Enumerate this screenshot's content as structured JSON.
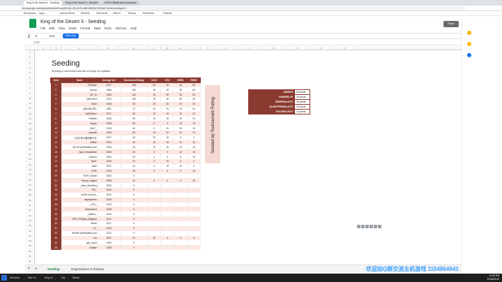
{
  "browser": {
    "tabs": [
      {
        "label": "King of the Desert 3 - Seeding"
      },
      {
        "label": "King of the Desert 3 - Bracket"
      },
      {
        "label": "KOD3 Official Announcement"
      }
    ],
    "url": "docs.google.com/spreadsheets/d/1sqkDiHuLh-5iXnFZh-w8KeBd3Is1HZ9wk9Tq/htmlview#gid=0",
    "bookmarks": [
      "Bookmarks",
      "Apps",
      "Android Boss",
      "Reverse",
      "Overmuse",
      "Sktech",
      "Bootsy",
      "Jw4Ometa",
      "Fanfolio"
    ]
  },
  "sheets": {
    "title": "King of the Desert 3 - Seeding",
    "menu": [
      "File",
      "Edit",
      "View",
      "Insert",
      "Format",
      "Data",
      "Tools",
      "Add-ons",
      "Help"
    ],
    "zoom": "100%",
    "view_only_label": "View only",
    "formula_cell": "2250",
    "share_label": "Share"
  },
  "grid": {
    "col_letters": [
      "A",
      "B",
      "C",
      "D",
      "E",
      "F",
      "G",
      "H",
      "I",
      "J",
      "K",
      "L",
      "M",
      "N",
      "O",
      "P"
    ],
    "row_numbers": [
      "1",
      "2",
      "3",
      "4",
      "5",
      "6",
      "7",
      "8",
      "9",
      "10",
      "11",
      "12",
      "13",
      "14",
      "15",
      "16",
      "17",
      "18",
      "19",
      "20",
      "21",
      "22",
      "23",
      "24",
      "25",
      "26",
      "27",
      "28",
      "29",
      "30",
      "31",
      "32",
      "33",
      "34",
      "35",
      "36",
      "37",
      "38",
      "39",
      "40",
      "41",
      "42"
    ]
  },
  "content": {
    "title": "Seeding",
    "subtitle": "Seeding is now locked and will no longer be updated.",
    "table_headers": [
      "Seed",
      "Name",
      "Average 1v1",
      "Tournament Rating",
      "KoD1",
      "HC2",
      "RBW1",
      "RBW2"
    ],
    "rows": [
      [
        "1",
        "TheViper",
        "2417",
        "190",
        "60",
        "40",
        "40",
        "50"
      ],
      [
        "2",
        "Lierrey",
        "2366",
        "150",
        "40",
        "20",
        "30",
        "60"
      ],
      [
        "3",
        "Mr_Yo",
        "2400",
        "140",
        "30",
        "30",
        "30",
        "50"
      ],
      [
        "4",
        "[aM] Hera",
        "2372",
        "120",
        "10",
        "40",
        "30",
        "40"
      ],
      [
        "5",
        "Tatoh",
        "2346",
        "90",
        "20",
        "20",
        "20",
        "30"
      ],
      [
        "6",
        "[aM] MbL40C",
        "2381",
        "70",
        "20",
        "20",
        "10",
        "20"
      ],
      [
        "7",
        "[aM] Nicov",
        "2271",
        "50",
        "10",
        "10",
        "10",
        "20"
      ],
      [
        "8",
        "TheMax",
        "2336",
        "50",
        "10",
        "10",
        "10",
        "20"
      ],
      [
        "9",
        "Angan",
        "2338",
        "50",
        "0",
        "0",
        "10",
        "10"
      ],
      [
        "10",
        "_Zeu7_",
        "2318",
        "50",
        "0",
        "20",
        "20",
        "10"
      ],
      [
        "11",
        "Lacoath",
        "2263",
        "50",
        "10",
        "10",
        "20",
        "10"
      ],
      [
        "12",
        "十余万初九春印象卡什",
        "2407",
        "40",
        "20",
        "10",
        "0",
        "0"
      ],
      [
        "13",
        "Villese",
        "2324",
        "40",
        "10",
        "10",
        "10",
        "10"
      ],
      [
        "14",
        "ACCM (ASEBuilds.com",
        "2315",
        "40",
        "10",
        "10",
        "10",
        "10"
      ],
      [
        "15",
        "SaiJr_Stockwider",
        "2330",
        "20",
        "0",
        "0",
        "10",
        "10"
      ],
      [
        "16",
        "Capoch",
        "2303",
        "20",
        "0",
        "0",
        "0",
        "10"
      ],
      [
        "17",
        "BacT",
        "2239",
        "10",
        "0",
        "10",
        "0",
        "0"
      ],
      [
        "18",
        "slam",
        "2297",
        "20",
        "0",
        "10",
        "10",
        "0"
      ],
      [
        "19",
        "F1Re",
        "2278",
        "20",
        "0",
        "0",
        "0",
        "10"
      ],
      [
        "20",
        "PGP | Daniel",
        "2303",
        "0",
        "",
        "",
        "",
        ""
      ],
      [
        "21",
        "Heavy | miguel",
        "2239",
        "10",
        "0",
        "0",
        "0",
        "10"
      ],
      [
        "22",
        "_Aero_ShadSeq",
        "2250",
        "0",
        "",
        "",
        "",
        ""
      ],
      [
        "23",
        "Tim_",
        "2244",
        "0",
        "",
        "",
        "",
        ""
      ],
      [
        "24",
        "serick.rox.ielA_",
        "2231",
        "0",
        "",
        "",
        "",
        ""
      ],
      [
        "25",
        "saymyname",
        "2229",
        "0",
        "",
        "",
        "",
        ""
      ],
      [
        "26",
        "_JOX_",
        "2229",
        "0",
        "",
        "",
        "",
        ""
      ],
      [
        "27",
        "Robenstool",
        "2228",
        "0",
        "",
        "",
        "",
        ""
      ],
      [
        "28",
        "_Barkm_",
        "2226",
        "0",
        "",
        "",
        "",
        ""
      ],
      [
        "29",
        "PGP | PRNject_Belgium",
        "2221",
        "0",
        "",
        "",
        "",
        ""
      ],
      [
        "30",
        "Modri",
        "2217",
        "0",
        "",
        "",
        "",
        ""
      ],
      [
        "31",
        "Cl_",
        "2216",
        "0",
        "",
        "",
        "",
        ""
      ],
      [
        "32",
        "HIIARE (ASEBuilds.com",
        "2212",
        "0",
        "",
        "",
        "",
        ""
      ],
      [
        "33",
        "Isn",
        "2211",
        "20",
        "20",
        "0",
        "0",
        "0"
      ],
      [
        "34",
        "gilo_cloud",
        "2193",
        "0",
        "",
        "",
        "",
        ""
      ],
      [
        "35",
        "Grasse",
        "2185",
        "0",
        "",
        "",
        "",
        ""
      ]
    ],
    "seeded_by": "Seeded by Tournament Rating",
    "points": [
      {
        "label": "WINNER",
        "value": "60 points"
      },
      {
        "label": "RUNNER-UP",
        "value": "40 points"
      },
      {
        "label": "SEMIFINALISTS",
        "value": "30 points"
      },
      {
        "label": "QUARTERFINALISTS",
        "value": "20 points"
      },
      {
        "label": "8TH-FINALISTS",
        "value": "10 points"
      }
    ]
  },
  "sheet_tabs": [
    "Seeding",
    "Registrations & Ratings"
  ],
  "watermark": "欢迎加Q群交流主机游戏 1154864943",
  "taskbar": {
    "items": [
      "Windows",
      "Rise of...",
      "King of...",
      "Sig",
      "Steam"
    ],
    "time": "11:56 PM",
    "date": "10/18/2019"
  },
  "colors": {
    "accent": "#8b3a2f",
    "row_alt": "#fbe7e3",
    "seeded_bg": "#f6d8d2",
    "sheets_green": "#0f9d58"
  }
}
